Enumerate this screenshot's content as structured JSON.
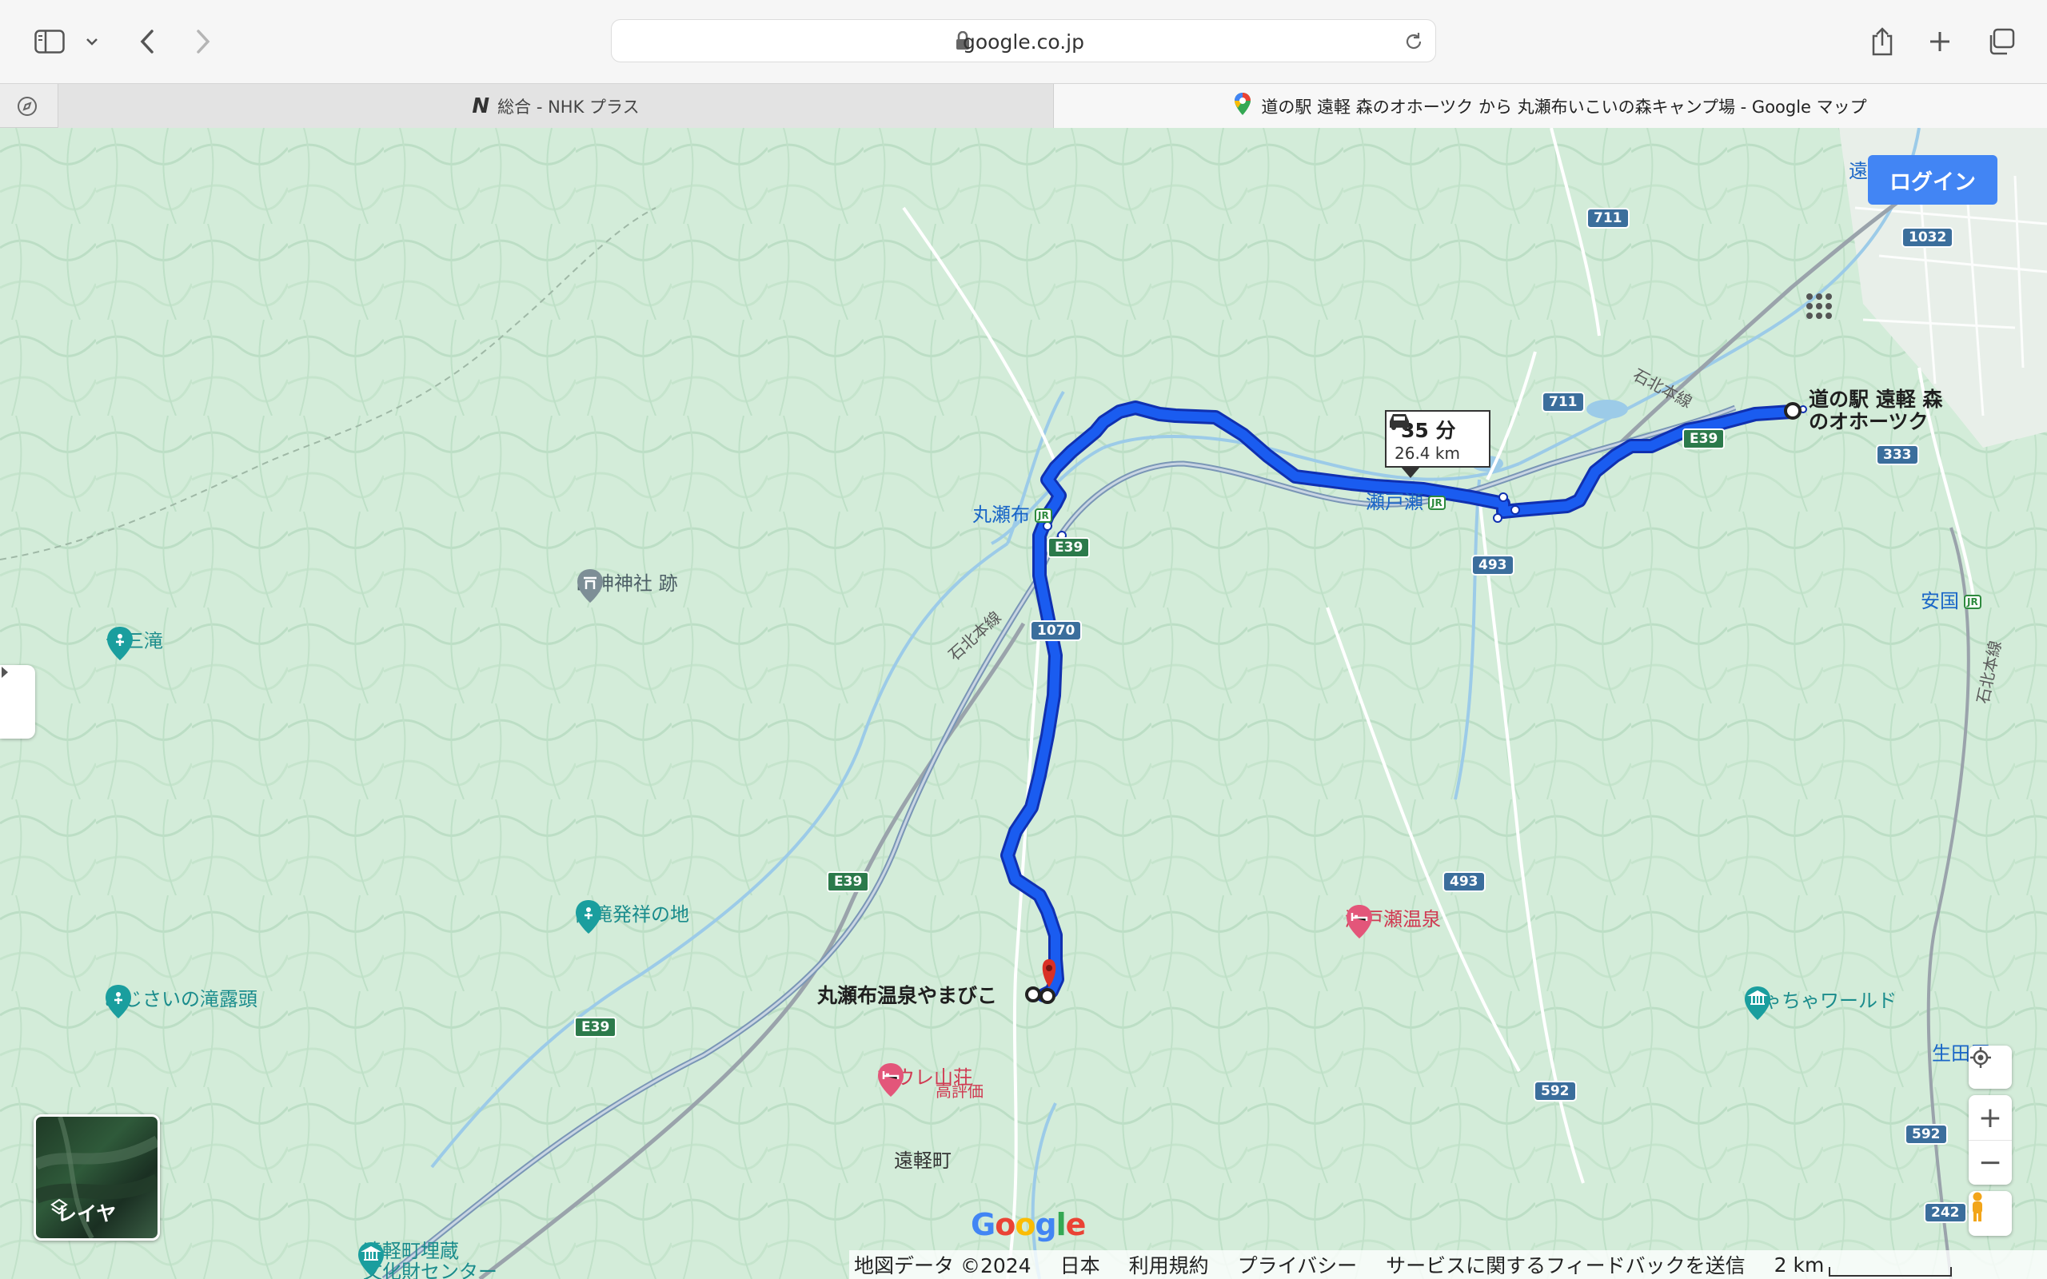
{
  "browser": {
    "url": "google.co.jp",
    "tabs": [
      {
        "label": "総合 - NHK プラス",
        "icon": "nhk-logo",
        "active": false
      },
      {
        "label": "道の駅 遠軽 森のオホーツク から 丸瀬布いこいの森キャンプ場 - Google マップ",
        "icon": "google-maps-pin",
        "active": true
      }
    ]
  },
  "map": {
    "login_label": "ログイン",
    "layer_label": "レイヤ",
    "route": {
      "time": "35 分",
      "distance": "26.4 km"
    },
    "origin_label_line1": "道の駅 遠軽 森",
    "origin_label_line2": "のオホーツク",
    "destination_label": "丸瀬布温泉やまびこ",
    "places": {
      "maruseppu_station": "丸瀬布",
      "setose_station": "瀬戸瀬",
      "yasukuni_station": "安国",
      "sanjin_shrine": "山神神社 跡",
      "jusan_taki": "十三滝",
      "shirataki_origin": "白滝発祥の地",
      "ajisai_falls": "あじさいの滝露頭",
      "setose_onsen": "瀬戸瀬温泉",
      "maure_sanso": "マウレ山荘",
      "maure_rating": "高評価",
      "engaru_town": "遠軽町",
      "chacha_world": "ちゃちゃワールド",
      "ikutahara": "生田原",
      "burial_center_1": "遠軽町埋蔵",
      "burial_center_2": "文化財センター",
      "engaru_top": "遠"
    },
    "rail_label": "石北本線",
    "roads": {
      "r711a": "711",
      "r711b": "711",
      "r1032": "1032",
      "r333": "333",
      "e39a": "E39",
      "e39b": "E39",
      "e39c": "E39",
      "e39d": "E39",
      "r493a": "493",
      "r493b": "493",
      "r1070": "1070",
      "r592a": "592",
      "r592b": "592",
      "r242": "242"
    },
    "attribution": {
      "data": "地図データ ©2024",
      "country": "日本",
      "terms": "利用規約",
      "privacy": "プライバシー",
      "feedback": "サービスに関するフィードバックを送信",
      "scale": "2 km"
    },
    "google_logo": "Google"
  },
  "colors": {
    "route": "#1a5cf0",
    "route_outline": "#1030b0",
    "login": "#4285f4",
    "map_bg": "#cfe9d6"
  }
}
